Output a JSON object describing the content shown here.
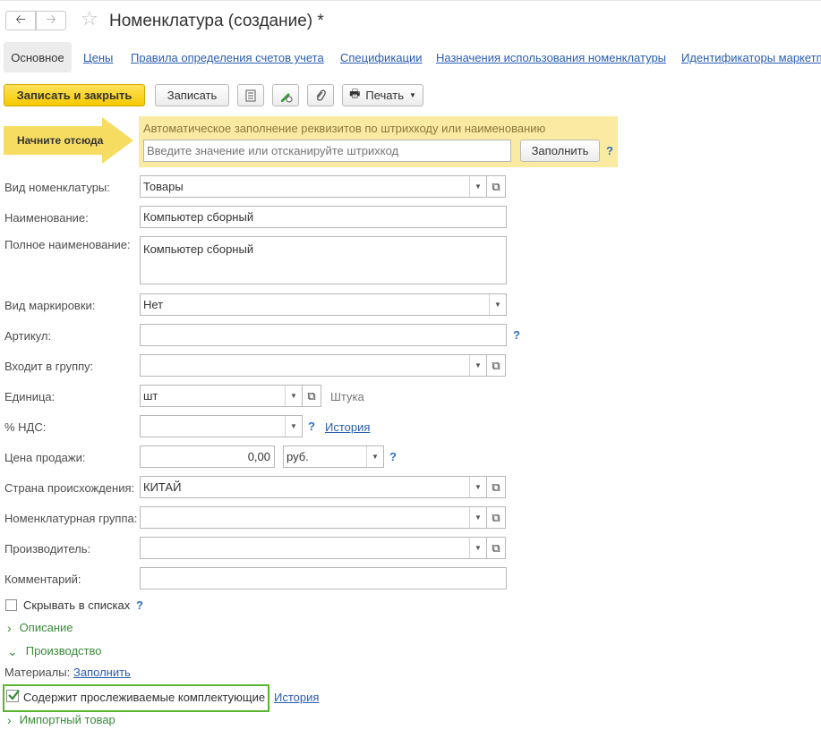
{
  "window": {
    "title": "Номенклатура (создание) *"
  },
  "tabs": [
    {
      "label": "Основное"
    },
    {
      "label": "Цены"
    },
    {
      "label": "Правила определения счетов учета"
    },
    {
      "label": "Спецификации"
    },
    {
      "label": "Назначения использования номенклатуры"
    },
    {
      "label": "Идентификаторы маркетпле"
    }
  ],
  "toolbar": {
    "save_close": "Записать и закрыть",
    "save": "Записать",
    "print": "Печать"
  },
  "autofill": {
    "start_here": "Начните отсюда",
    "hint": "Автоматическое заполнение реквизитов по штрихкоду или наименованию",
    "placeholder": "Введите значение или отсканируйте штрихкод",
    "fill_button": "Заполнить",
    "help": "?"
  },
  "form": {
    "kind": {
      "label": "Вид номенклатуры:",
      "value": "Товары"
    },
    "name": {
      "label": "Наименование:",
      "value": "Компьютер сборный"
    },
    "full_name": {
      "label": "Полное наименование:",
      "value": "Компьютер сборный"
    },
    "marking": {
      "label": "Вид маркировки:",
      "value": "Нет"
    },
    "article": {
      "label": "Артикул:",
      "value": "",
      "help": "?"
    },
    "group": {
      "label": "Входит в группу:",
      "value": ""
    },
    "unit": {
      "label": "Единица:",
      "value": "шт",
      "description": "Штука"
    },
    "vat": {
      "label": "% НДС:",
      "value": "",
      "help": "?",
      "history": "История"
    },
    "price": {
      "label": "Цена продажи:",
      "value": "0,00",
      "currency": "руб.",
      "help": "?"
    },
    "country": {
      "label": "Страна происхождения:",
      "value": "КИТАЙ"
    },
    "nomen_group": {
      "label": "Номенклатурная группа:",
      "value": ""
    },
    "manufacturer": {
      "label": "Производитель:",
      "value": ""
    },
    "comment": {
      "label": "Комментарий:",
      "value": ""
    },
    "hide_in_lists": {
      "label": "Скрывать в списках",
      "help": "?"
    },
    "sections": {
      "description": "Описание",
      "production": "Производство",
      "import": "Импортный товар"
    },
    "materials": {
      "label": "Материалы:",
      "fill": "Заполнить"
    },
    "tracked": {
      "label": "Содержит прослеживаемые комплектующие",
      "history": "История"
    }
  },
  "colors": {
    "accent_yellow": "#f5c900",
    "panel_yellow": "#faeaa2",
    "link_blue": "#2a5db0",
    "highlight_green": "#5cb531"
  }
}
